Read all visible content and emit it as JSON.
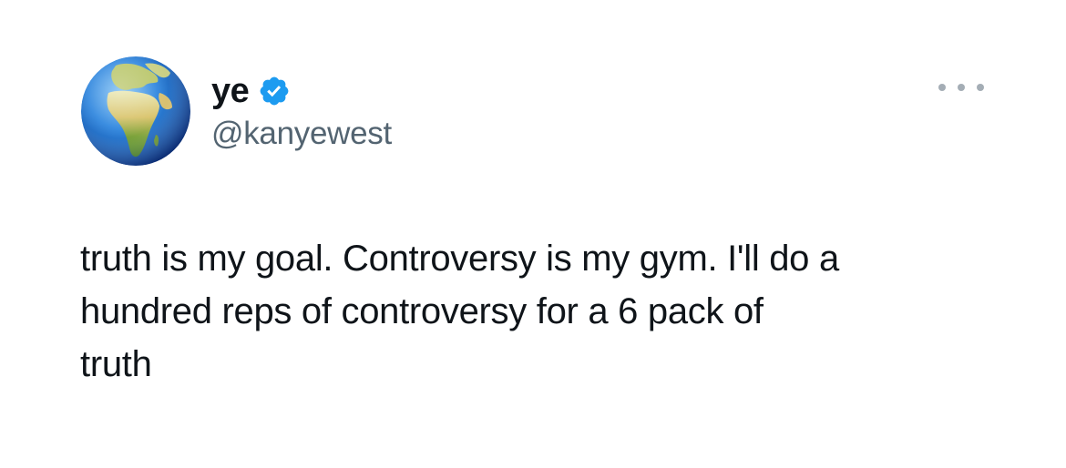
{
  "tweet": {
    "author": {
      "display_name": "ye",
      "handle": "@kanyewest",
      "verified": true,
      "avatar_icon": "globe-europe-africa-icon"
    },
    "more_icon": "more-options-icon",
    "text": "truth is my goal. Controversy is my gym. I'll do a\nhundred reps of controversy for a 6 pack of\ntruth"
  },
  "colors": {
    "text_primary": "#0f1419",
    "text_secondary": "#536471",
    "verified_blue": "#1d9bf0",
    "background": "#ffffff"
  }
}
